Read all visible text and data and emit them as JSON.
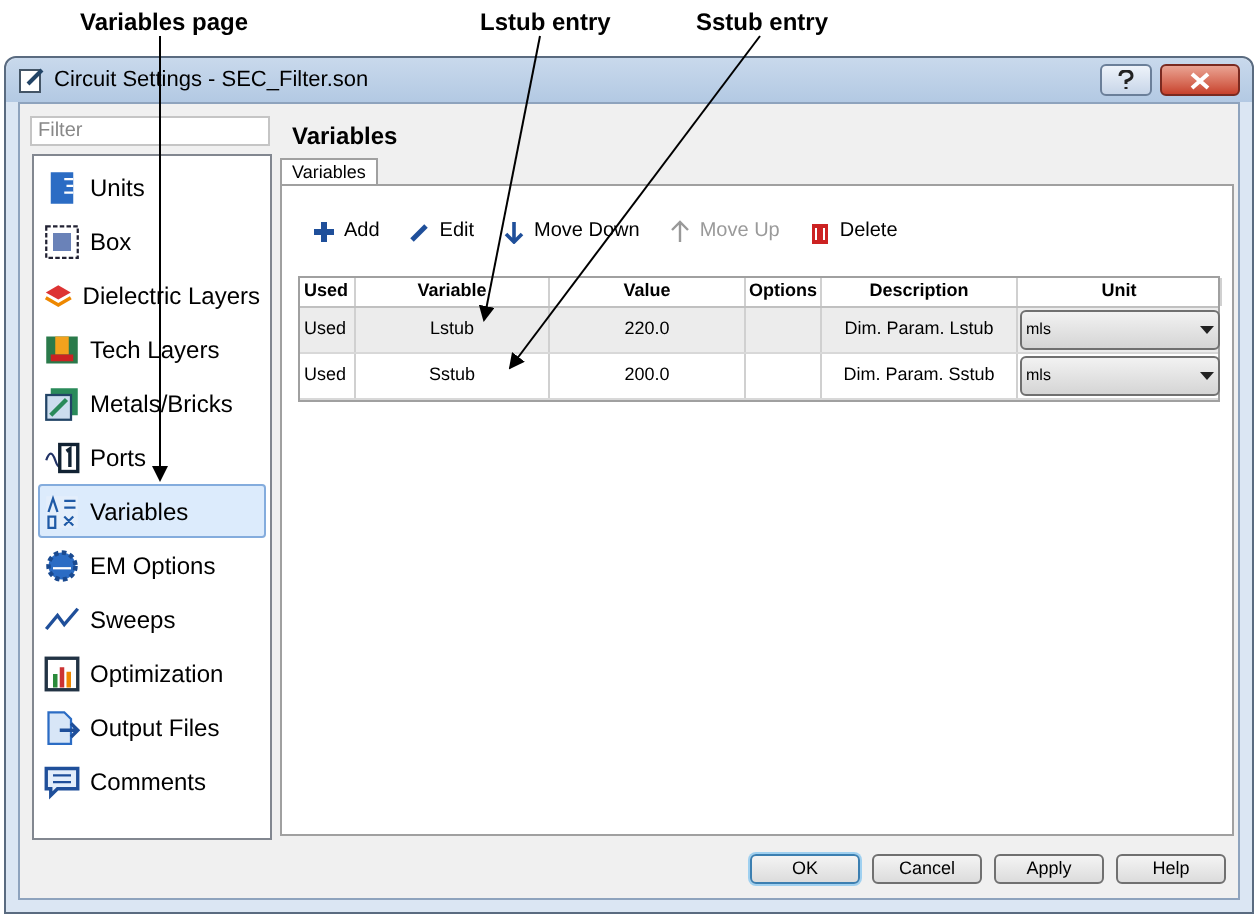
{
  "annotations": [
    {
      "label": "Variables page"
    },
    {
      "label": "Lstub entry"
    },
    {
      "label": "Sstub entry"
    }
  ],
  "window": {
    "title": "Circuit Settings - SEC_Filter.son"
  },
  "filter": {
    "placeholder": "Filter"
  },
  "sidebar": {
    "items": [
      {
        "label": "Units",
        "kind": "units",
        "selected": false
      },
      {
        "label": "Box",
        "kind": "box",
        "selected": false
      },
      {
        "label": "Dielectric Layers",
        "kind": "layers",
        "selected": false
      },
      {
        "label": "Tech Layers",
        "kind": "tech",
        "selected": false
      },
      {
        "label": "Metals/Bricks",
        "kind": "metals",
        "selected": false
      },
      {
        "label": "Ports",
        "kind": "ports",
        "selected": false
      },
      {
        "label": "Variables",
        "kind": "variables",
        "selected": true
      },
      {
        "label": "EM Options",
        "kind": "em",
        "selected": false
      },
      {
        "label": "Sweeps",
        "kind": "sweeps",
        "selected": false
      },
      {
        "label": "Optimization",
        "kind": "chart",
        "selected": false
      },
      {
        "label": "Output Files",
        "kind": "output",
        "selected": false
      },
      {
        "label": "Comments",
        "kind": "comments",
        "selected": false
      }
    ]
  },
  "page_title": "Variables",
  "tabs": [
    {
      "label": "Variables",
      "selected": true
    }
  ],
  "toolbar": [
    {
      "label": "Add",
      "kind": "add",
      "disabled": false
    },
    {
      "label": "Edit",
      "kind": "edit",
      "disabled": false
    },
    {
      "label": "Move Down",
      "kind": "down",
      "disabled": false
    },
    {
      "label": "Move Up",
      "kind": "up",
      "disabled": true
    },
    {
      "label": "Delete",
      "kind": "delete",
      "disabled": false
    }
  ],
  "table": {
    "columns": [
      "Used",
      "Variable",
      "Value",
      "Options",
      "Description",
      "Unit"
    ],
    "rows": [
      {
        "used": "Used",
        "variable": "Lstub",
        "value": "220.0",
        "description": "Dim. Param. Lstub",
        "unit": "mls",
        "selected": true
      },
      {
        "used": "Used",
        "variable": "Sstub",
        "value": "200.0",
        "description": "Dim. Param. Sstub",
        "unit": "mls",
        "selected": false
      }
    ]
  },
  "buttons": [
    {
      "label": "OK",
      "default": true
    },
    {
      "label": "Cancel",
      "default": false
    },
    {
      "label": "Apply",
      "default": false
    },
    {
      "label": "Help",
      "default": false
    }
  ]
}
